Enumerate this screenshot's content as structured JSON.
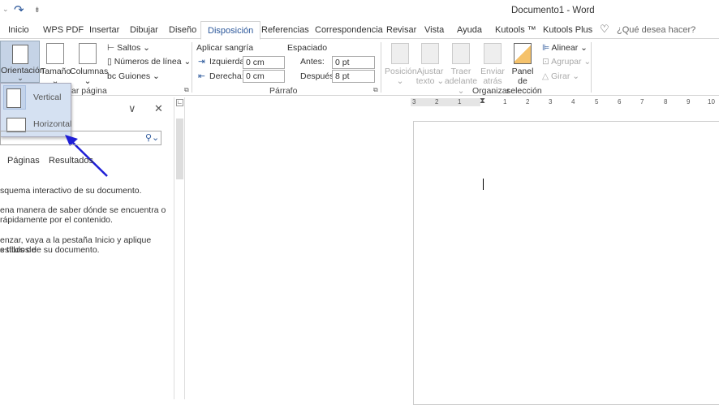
{
  "quick_access": {
    "redo": "↷",
    "customize": "⇟"
  },
  "title": "Documento1  -  Word",
  "tabs": [
    "Inicio",
    "WPS PDF",
    "Insertar",
    "Dibujar",
    "Diseño",
    "Disposición",
    "Referencias",
    "Correspondencia",
    "Revisar",
    "Vista",
    "Ayuda",
    "Kutools ™",
    "Kutools Plus"
  ],
  "active_tab": "Disposición",
  "tell_me": "¿Qué desea hacer?",
  "page_setup": {
    "orientation": "Orientación",
    "size": "Tamaño",
    "columns": "Columnas",
    "breaks": "Saltos",
    "line_numbers": "Números de línea",
    "hyphenation": "Guiones",
    "group_label": "ar página"
  },
  "paragraph": {
    "indent_label": "Aplicar sangría",
    "left_label": "Izquierda:",
    "left_value": "0 cm",
    "right_label": "Derecha:",
    "right_value": "0 cm",
    "spacing_label": "Espaciado",
    "before_label": "Antes:",
    "before_value": "0 pt",
    "after_label": "Después:",
    "after_value": "8 pt",
    "group_label": "Párrafo"
  },
  "arrange": {
    "position": [
      "Posición",
      ""
    ],
    "wrap": [
      "Ajustar",
      "texto"
    ],
    "forward": [
      "Traer",
      "adelante"
    ],
    "backward": [
      "Enviar",
      "atrás"
    ],
    "selection": [
      "Panel de",
      "selección"
    ],
    "align": "Alinear",
    "group": "Agrupar",
    "rotate": "Girar",
    "group_label": "Organizar"
  },
  "orientation_menu": {
    "items": [
      "Vertical",
      "Horizontal"
    ]
  },
  "nav_pane": {
    "tabs": [
      "Páginas",
      "Resultados"
    ],
    "lines": [
      "squema interactivo de su documento.",
      "ena manera de saber dónde se encuentra o",
      "rápidamente por el contenido.",
      "enzar, vaya a la pestaña Inicio y aplique estilos de",
      "s títulos de su documento."
    ]
  },
  "ruler": {
    "labels": [
      "3",
      "2",
      "1",
      "",
      "1",
      "2",
      "3",
      "4",
      "5",
      "6",
      "7",
      "8",
      "9",
      "10"
    ]
  },
  "annotation_color": "#1f1fd6"
}
